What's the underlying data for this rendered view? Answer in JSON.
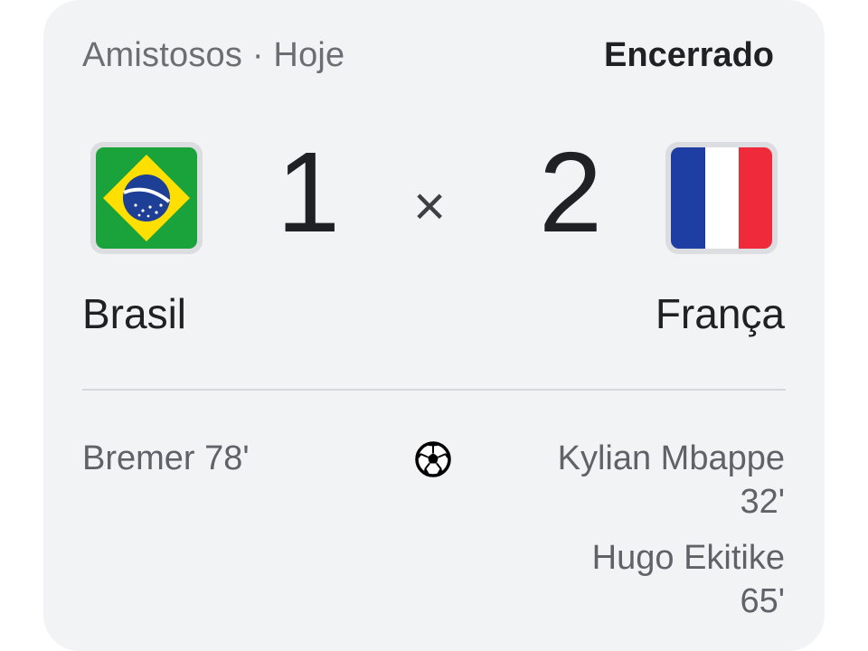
{
  "match": {
    "competition": "Amistosos · Hoje",
    "status": "Encerrado",
    "separator": "×"
  },
  "home": {
    "name": "Brasil",
    "score": "1",
    "flag_icon": "brazil-flag-icon",
    "scorers": [
      "Bremer 78'"
    ]
  },
  "away": {
    "name": "França",
    "score": "2",
    "flag_icon": "france-flag-icon",
    "scorers": [
      "Kylian Mbappe 32'",
      "Hugo Ekitike 65'"
    ]
  },
  "icons": {
    "goal": "soccer-ball-icon"
  },
  "colors": {
    "card_bg": "#f2f3f5",
    "text_primary": "#202124",
    "text_secondary": "#5f6368",
    "brazil_green": "#1aa33a",
    "brazil_yellow": "#ffdf00",
    "brazil_blue": "#1d3f95",
    "france_blue": "#1f3ea3",
    "france_white": "#ffffff",
    "france_red": "#ee2a3b"
  }
}
